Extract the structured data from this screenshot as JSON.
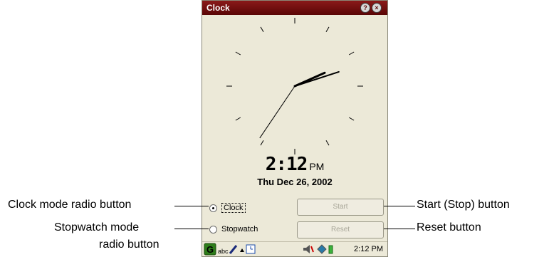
{
  "window": {
    "title": "Clock",
    "help_icon": "help-icon",
    "close_icon": "close-icon"
  },
  "clock": {
    "hour": 2,
    "minute": 12
  },
  "digital": {
    "hours": "2",
    "separator": ":",
    "minutes": "12",
    "ampm": "PM",
    "date": "Thu Dec 26, 2002"
  },
  "modes": {
    "clock_label": "Clock",
    "stopwatch_label": "Stopwatch",
    "selected": "clock"
  },
  "buttons": {
    "start_label": "Start",
    "reset_label": "Reset",
    "enabled": false
  },
  "taskbar": {
    "input_label": "abc",
    "time": "2:12 PM"
  },
  "callouts": {
    "clock_mode": "Clock mode radio button",
    "stopwatch_line1": "Stopwatch mode",
    "stopwatch_line2": "radio button",
    "start_stop": "Start (Stop) button",
    "reset": "Reset button"
  }
}
